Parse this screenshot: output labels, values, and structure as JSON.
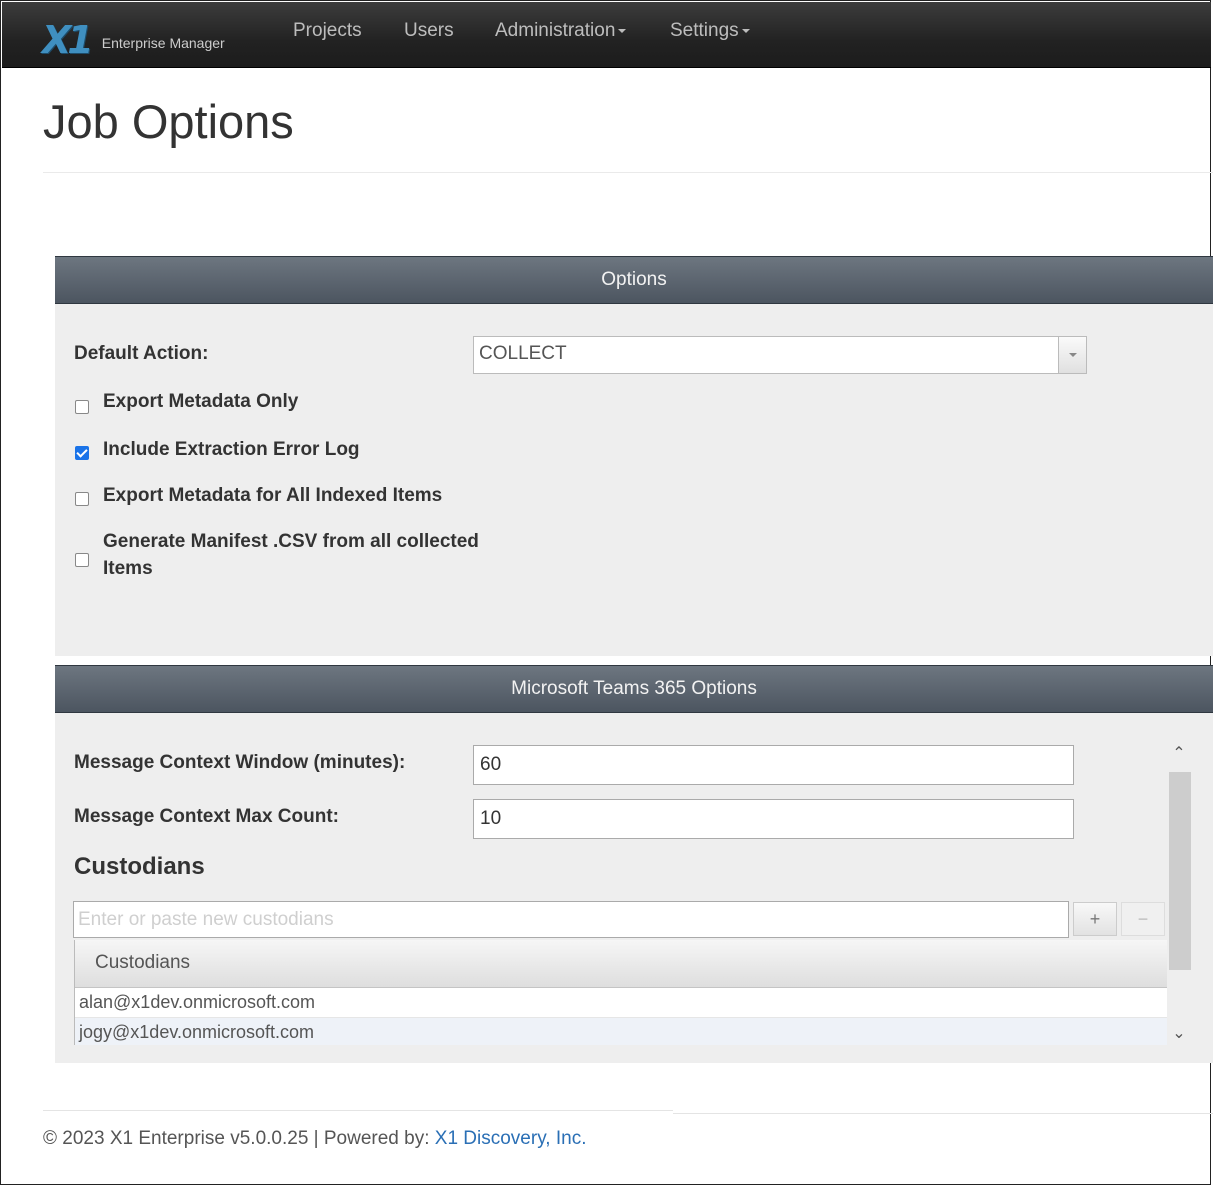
{
  "navbar": {
    "brand_logo": "X1",
    "brand_text": "Enterprise Manager",
    "items": [
      {
        "label": "Projects"
      },
      {
        "label": "Users"
      },
      {
        "label": "Administration"
      },
      {
        "label": "Settings"
      }
    ]
  },
  "page": {
    "title": "Job Options"
  },
  "options_panel": {
    "header": "Options",
    "default_action_label": "Default Action:",
    "default_action_value": "COLLECT",
    "checkboxes": [
      {
        "label": "Export Metadata Only",
        "checked": false
      },
      {
        "label": "Include Extraction Error Log",
        "checked": true
      },
      {
        "label": "Export Metadata for All Indexed Items",
        "checked": false
      },
      {
        "label": "Generate Manifest .CSV from all collected Items",
        "checked": false
      }
    ]
  },
  "teams_panel": {
    "header": "Microsoft Teams 365 Options",
    "context_window_label": "Message Context Window (minutes):",
    "context_window_value": "60",
    "max_count_label": "Message Context Max Count:",
    "max_count_value": "10",
    "custodians_heading": "Custodians",
    "custodian_placeholder": "Enter or paste new custodians",
    "add_button": "+",
    "remove_button": "−",
    "table_header": "Custodians",
    "custodians": [
      "alan@x1dev.onmicrosoft.com",
      "jogy@x1dev.onmicrosoft.com"
    ]
  },
  "footer": {
    "text": "© 2023  X1 Enterprise v5.0.0.25 | Powered by:",
    "link": "X1 Discovery, Inc."
  },
  "colors": {
    "navbar": "#222222",
    "brand_accent": "#3f8fc0",
    "panel_header": "#5a636d",
    "checkbox_checked": "#1a73e8",
    "link": "#2a6fb5"
  }
}
